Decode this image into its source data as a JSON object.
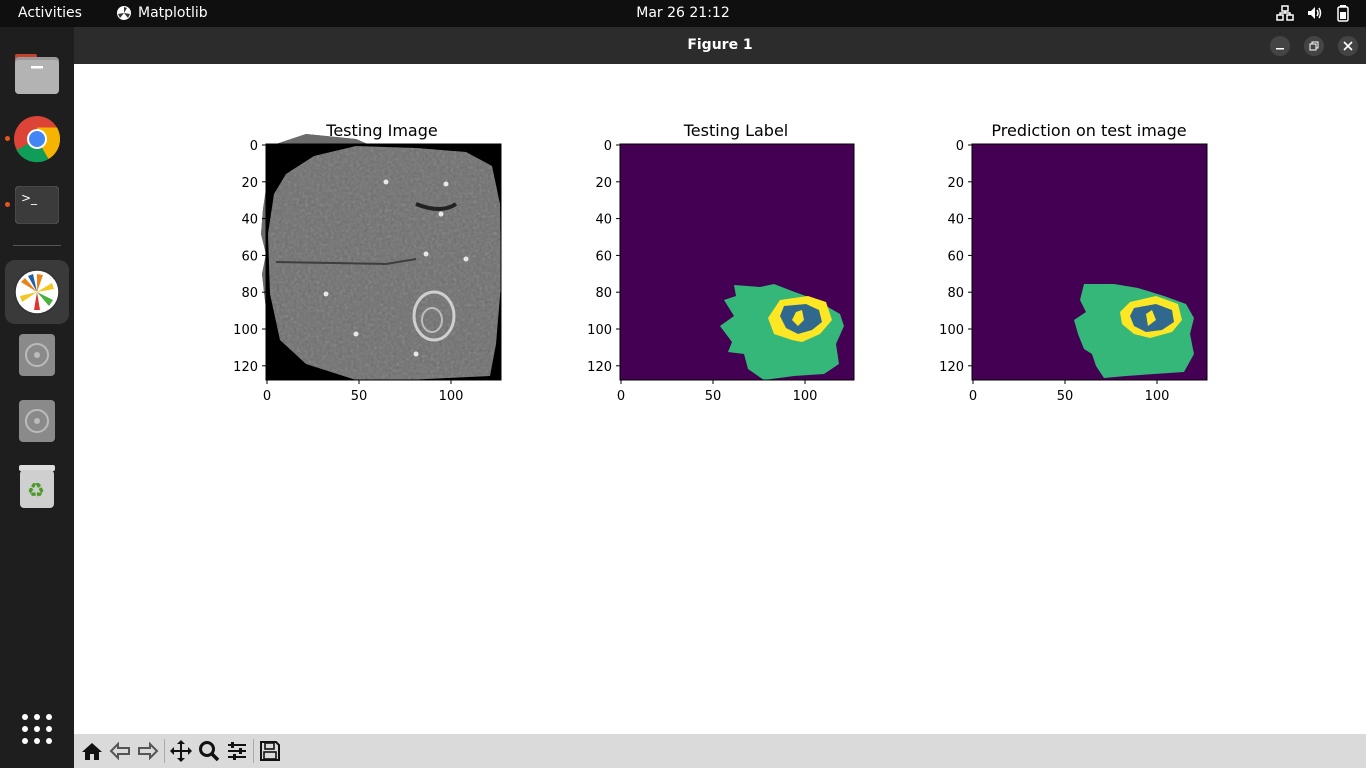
{
  "topbar": {
    "activities": "Activities",
    "app_name": "Matplotlib",
    "clock": "Mar 26  21:12"
  },
  "window": {
    "title": "Figure 1"
  },
  "figure": {
    "panels": [
      {
        "title": "Testing Image",
        "colormap": "gray"
      },
      {
        "title": "Testing Label",
        "colormap": "viridis"
      },
      {
        "title": "Prediction on test image",
        "colormap": "viridis"
      }
    ],
    "y_ticks": [
      "0",
      "20",
      "40",
      "60",
      "80",
      "100",
      "120"
    ],
    "x_ticks": [
      "0",
      "50",
      "100"
    ]
  },
  "colors": {
    "viridis_bg": "#440154",
    "viridis_green": "#35b779",
    "viridis_blue": "#31688e",
    "viridis_yellow": "#fde725"
  },
  "toolbar": [
    "home-icon",
    "back-icon",
    "forward-icon",
    "pan-icon",
    "zoom-icon",
    "configure-icon",
    "save-icon"
  ]
}
